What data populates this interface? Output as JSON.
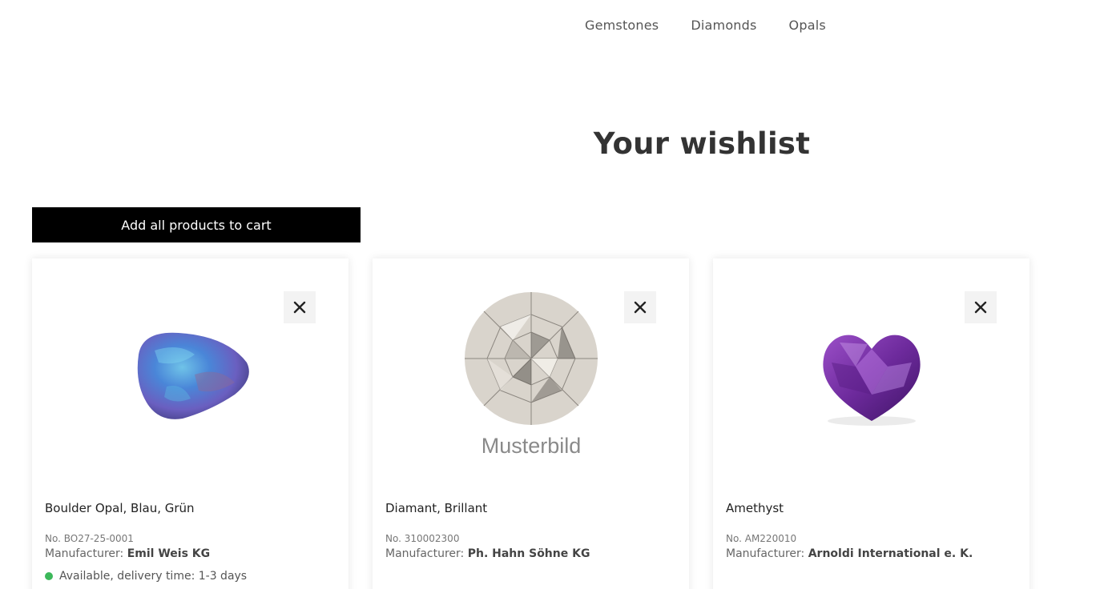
{
  "nav": {
    "items": [
      "Gemstones",
      "Diamonds",
      "Opals"
    ]
  },
  "page": {
    "title": "Your wishlist"
  },
  "actions": {
    "add_all_label": "Add all products to cart"
  },
  "products": [
    {
      "name": "Boulder Opal, Blau, Grün",
      "no": "No. BO27-25-0001",
      "manufacturer_label": "Manufacturer:",
      "manufacturer": "Emil Weis KG",
      "availability": "Available, delivery time: 1-3 days",
      "availability_color": "#3cb85a"
    },
    {
      "name": "Diamant, Brillant",
      "no": "No. 310002300",
      "manufacturer_label": "Manufacturer:",
      "manufacturer": "Ph. Hahn Söhne KG",
      "image_caption": "Musterbild"
    },
    {
      "name": "Amethyst",
      "no": "No. AM220010",
      "manufacturer_label": "Manufacturer:",
      "manufacturer": "Arnoldi International e. K."
    }
  ],
  "icons": {
    "remove": "close-icon"
  }
}
